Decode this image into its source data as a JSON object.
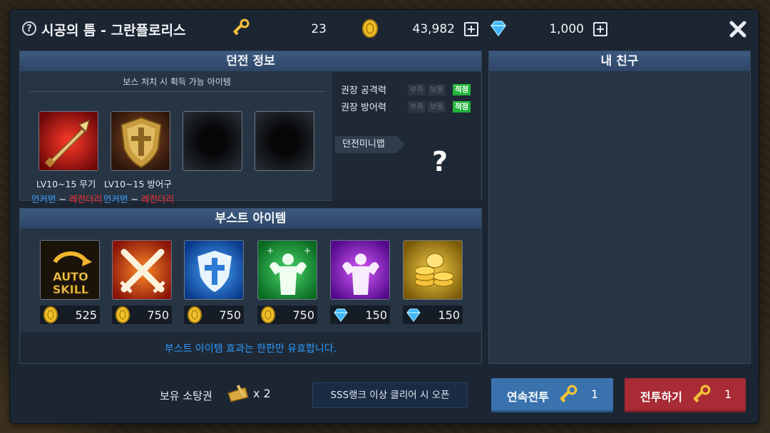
{
  "header": {
    "title": "시공의 틈 - 그란플로리스",
    "help_icon": "question-mark-icon",
    "resources": [
      {
        "icon": "key-icon",
        "value": "23",
        "has_plus": false
      },
      {
        "icon": "gold-coin-icon",
        "value": "43,982",
        "has_plus": true
      },
      {
        "icon": "diamond-icon",
        "value": "1,000",
        "has_plus": true
      }
    ],
    "close_icon": "close-icon",
    "plus_glyph": "+"
  },
  "dungeon_info": {
    "title": "던전 정보",
    "reward_caption": "보스 처치 시 획득 가능 아이템",
    "rewards": [
      {
        "icon": "sword-icon",
        "level_label": "LV10~15 무기",
        "rarity_from": "언커먼",
        "rarity_sep": "~",
        "rarity_to": "레전더리"
      },
      {
        "icon": "shield-icon",
        "level_label": "LV10~15 방어구",
        "rarity_from": "언커먼",
        "rarity_sep": "~",
        "rarity_to": "레전더리"
      },
      {
        "icon": "unknown-item",
        "level_label": "",
        "rarity_from": "",
        "rarity_sep": "",
        "rarity_to": ""
      },
      {
        "icon": "unknown-item",
        "level_label": "",
        "rarity_from": "",
        "rarity_sep": "",
        "rarity_to": ""
      }
    ],
    "stats": [
      {
        "name": "권장 공격력",
        "levels": [
          "부족",
          "보통",
          "적정"
        ],
        "active": 2
      },
      {
        "name": "권장 방어력",
        "levels": [
          "부족",
          "보통",
          "적정"
        ],
        "active": 2
      }
    ],
    "minimap_label": "던전미니맵",
    "minimap_placeholder": "?"
  },
  "boost_items": {
    "title": "부스트 아이템",
    "items": [
      {
        "icon": "auto-skill-icon",
        "icon_text_1": "AUTO",
        "icon_text_2": "SKILL",
        "currency": "gold-coin-icon",
        "price": "525"
      },
      {
        "icon": "crossed-swords-icon",
        "currency": "gold-coin-icon",
        "price": "750"
      },
      {
        "icon": "holy-shield-icon",
        "currency": "gold-coin-icon",
        "price": "750"
      },
      {
        "icon": "strength-buff-icon",
        "currency": "gold-coin-icon",
        "price": "750"
      },
      {
        "icon": "strength-purple-icon",
        "currency": "diamond-icon",
        "price": "150"
      },
      {
        "icon": "gold-coins-icon",
        "currency": "diamond-icon",
        "price": "150"
      }
    ],
    "note": "부스트 아이템 효과는 한판만 유효합니다."
  },
  "friends": {
    "title": "내 친구"
  },
  "footer": {
    "ticket_label": "보유 소탕권",
    "ticket_icon": "sweep-ticket-icon",
    "ticket_count": "x 2",
    "sweep_button": "SSS랭크 이상 클리어 시 오픈",
    "continue_button": {
      "label": "연속전투",
      "icon": "key-icon",
      "count": "1"
    },
    "fight_button": {
      "label": "전투하기",
      "icon": "key-icon",
      "count": "1"
    }
  },
  "colors": {
    "panel_header": "#3d5a80",
    "rarity_uncommon": "#3ea2ff",
    "rarity_legendary": "#ff3030",
    "stat_active": "#22b53a",
    "note_text": "#2e9bff",
    "continue_button": "#3a72ad",
    "fight_button": "#a82b35"
  }
}
